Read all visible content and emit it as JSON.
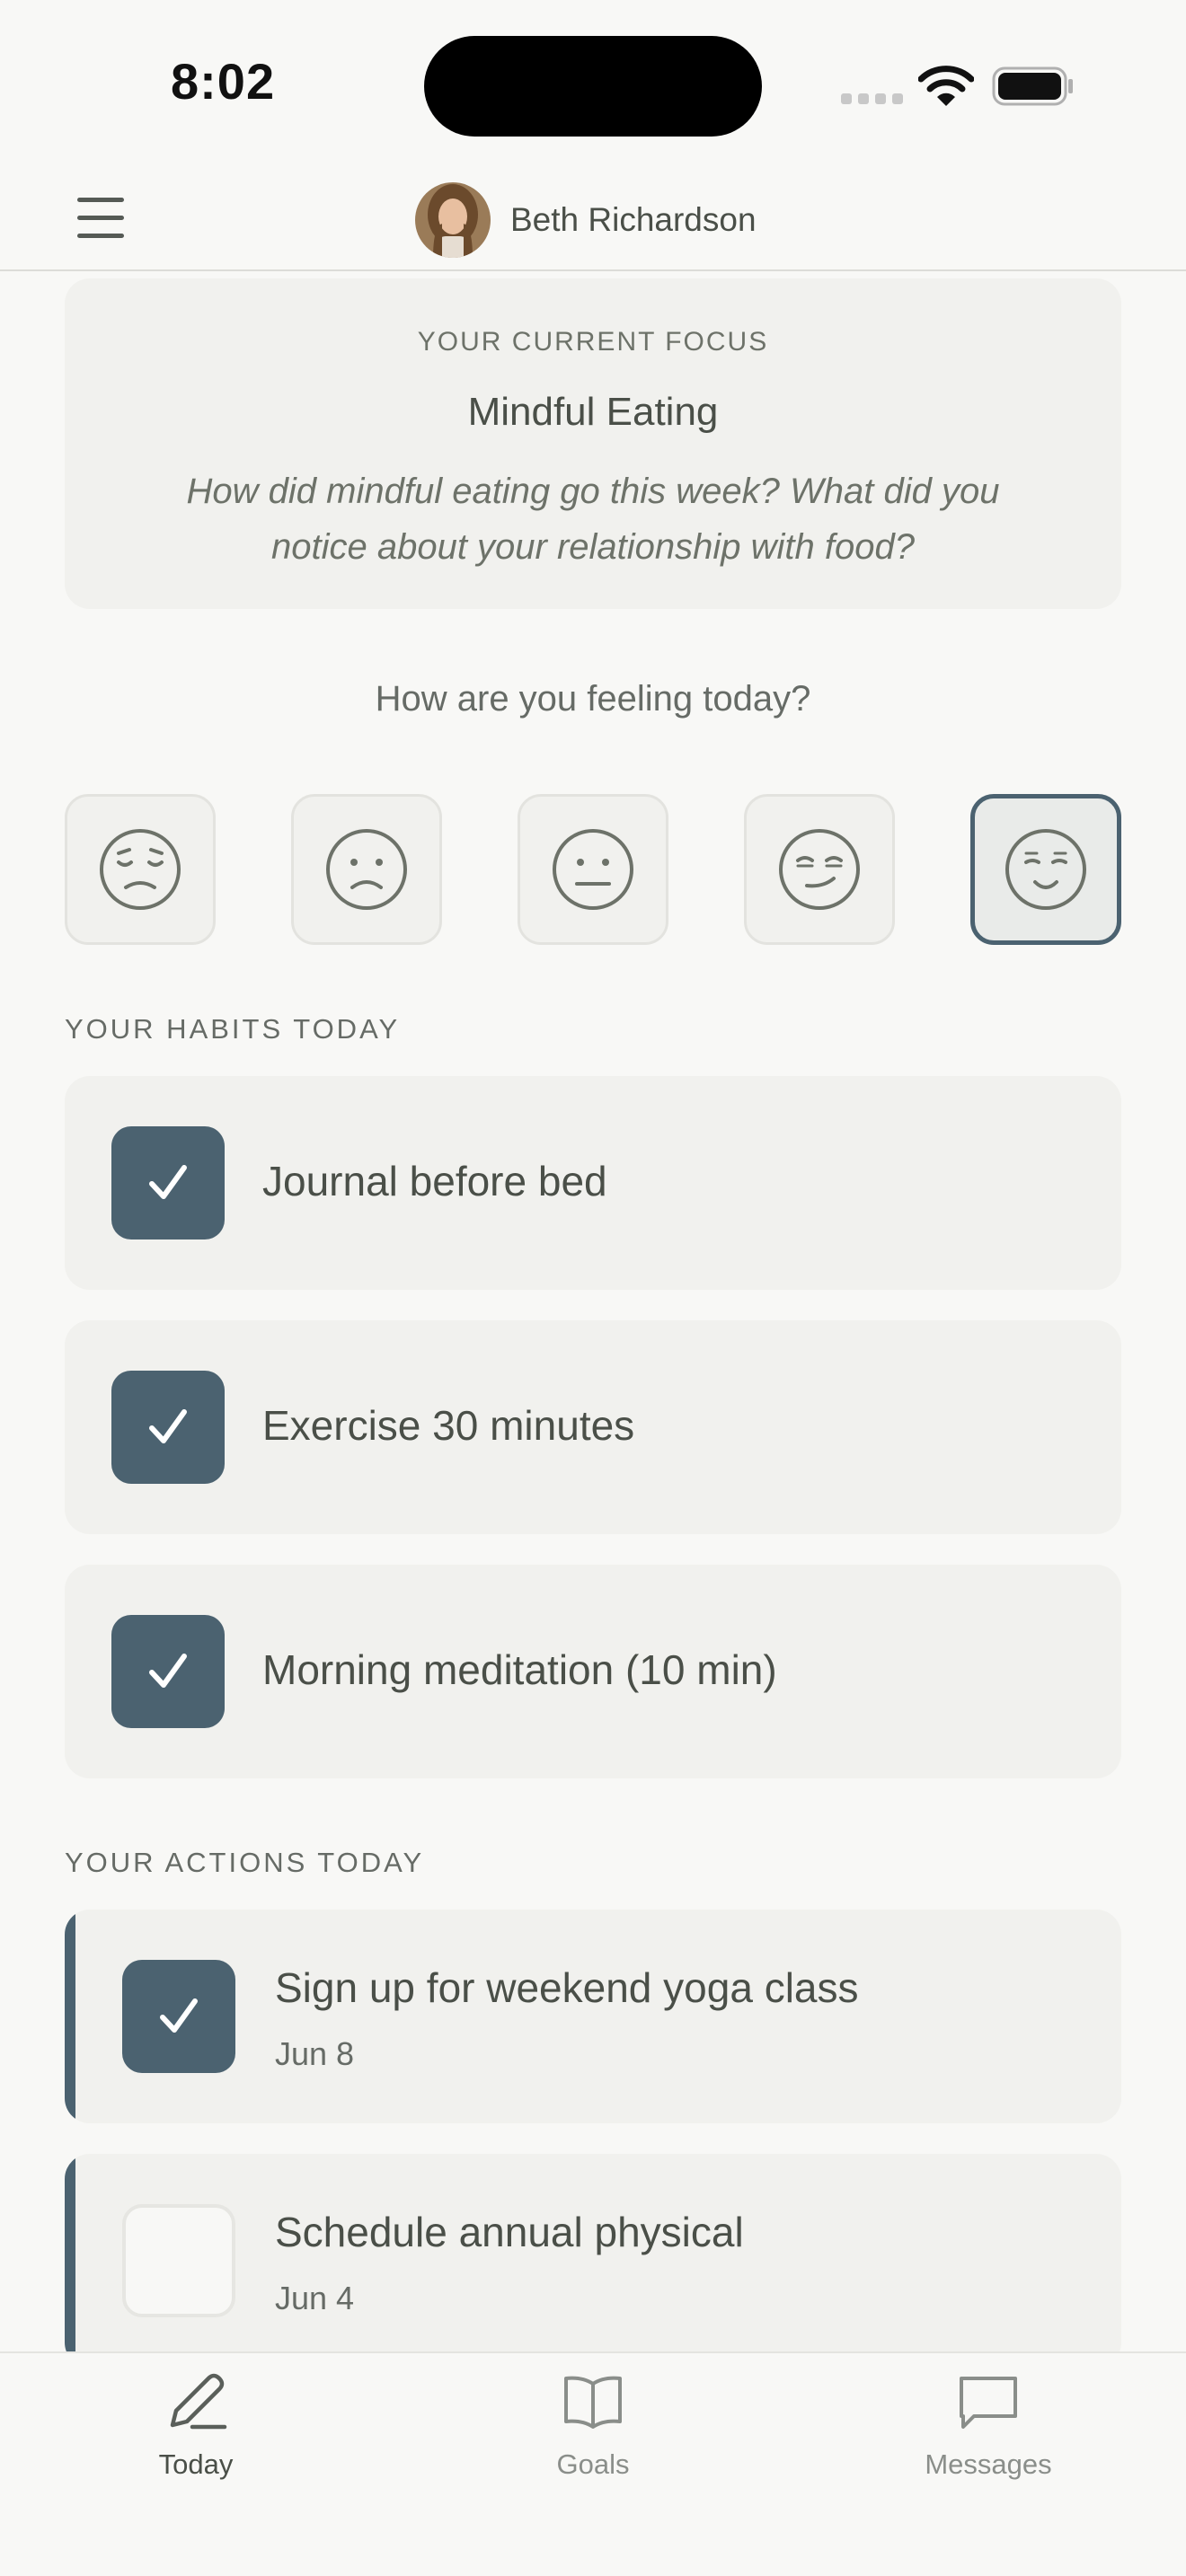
{
  "status_bar": {
    "time": "8:02"
  },
  "header": {
    "user_name": "Beth Richardson"
  },
  "focus": {
    "eyebrow": "YOUR CURRENT FOCUS",
    "title": "Mindful Eating",
    "prompt": "How did mindful eating go this week? What did you notice about your relationship with food?"
  },
  "mood": {
    "question": "How are you feeling today?",
    "options": [
      "very-sad-face-icon",
      "sad-face-icon",
      "neutral-face-icon",
      "smirk-face-icon",
      "content-face-icon"
    ],
    "selected_index": 4
  },
  "habits": {
    "section_label": "YOUR HABITS TODAY",
    "items": [
      {
        "label": "Journal before bed",
        "checked": true
      },
      {
        "label": "Exercise 30 minutes",
        "checked": true
      },
      {
        "label": "Morning meditation (10 min)",
        "checked": true
      }
    ]
  },
  "actions": {
    "section_label": "YOUR ACTIONS TODAY",
    "items": [
      {
        "title": "Sign up for weekend yoga class",
        "date": "Jun 8",
        "checked": true
      },
      {
        "title": "Schedule annual physical",
        "date": "Jun 4",
        "checked": false
      }
    ]
  },
  "tabs": [
    {
      "label": "Today",
      "icon": "pencil-icon",
      "active": true
    },
    {
      "label": "Goals",
      "icon": "book-icon",
      "active": false
    },
    {
      "label": "Messages",
      "icon": "chat-bubble-icon",
      "active": false
    }
  ],
  "colors": {
    "accent": "#4b6270",
    "card": "#f1f1ee",
    "background": "#f8f8f6"
  }
}
